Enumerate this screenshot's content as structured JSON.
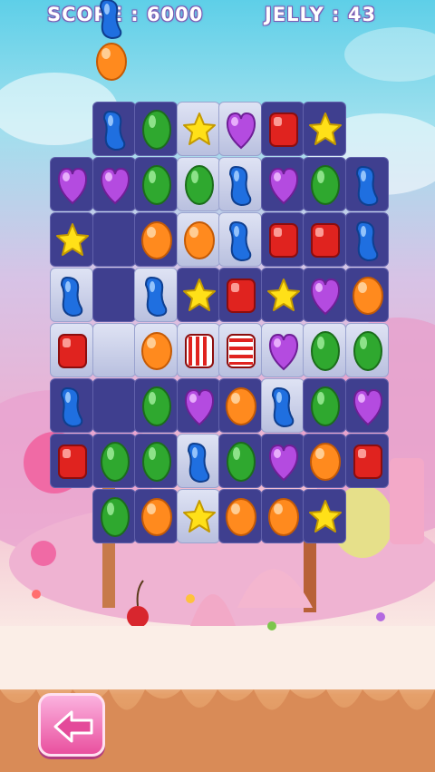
{
  "hud": {
    "score_label": "SCORE : 6000",
    "jelly_label": "JELLY : 43"
  },
  "colors": {
    "board": "#3f3f8f",
    "jelly_tile": "#d3d8ee",
    "hud_text": "#ffffff",
    "back_button": "#f07cc0"
  },
  "board": {
    "columns": 8,
    "rows": 8,
    "cells": [
      [
        "empty",
        "blue-bean",
        "green-oval",
        "yellow-star",
        "purple-heart",
        "red-square",
        "yellow-star",
        "empty"
      ],
      [
        "purple-heart",
        "purple-heart",
        "green-oval",
        "green-oval",
        "blue-bean",
        "purple-heart",
        "green-oval",
        "blue-bean"
      ],
      [
        "yellow-star",
        "empty",
        "orange-oval",
        "orange-oval",
        "blue-bean",
        "red-square",
        "red-square",
        "blue-bean"
      ],
      [
        "blue-bean",
        "empty",
        "blue-bean",
        "yellow-star",
        "red-square",
        "yellow-star",
        "purple-heart",
        "orange-oval"
      ],
      [
        "red-square",
        "empty",
        "orange-oval",
        "red-striped",
        "red-striped-h",
        "purple-heart",
        "green-oval",
        "green-oval"
      ],
      [
        "blue-bean",
        "empty",
        "green-oval",
        "purple-heart",
        "orange-oval",
        "blue-bean",
        "green-oval",
        "purple-heart"
      ],
      [
        "red-square",
        "green-oval",
        "green-oval",
        "blue-bean",
        "green-oval",
        "purple-heart",
        "orange-oval",
        "red-square"
      ],
      [
        "empty",
        "green-oval",
        "orange-oval",
        "yellow-star",
        "orange-oval",
        "orange-oval",
        "yellow-star",
        "empty"
      ]
    ],
    "jelly": [
      [
        0,
        0,
        0,
        1,
        1,
        0,
        0,
        0
      ],
      [
        0,
        0,
        0,
        1,
        1,
        0,
        0,
        0
      ],
      [
        0,
        0,
        0,
        1,
        1,
        0,
        0,
        0
      ],
      [
        1,
        0,
        1,
        0,
        0,
        0,
        0,
        0
      ],
      [
        1,
        1,
        1,
        1,
        1,
        1,
        1,
        1
      ],
      [
        0,
        0,
        0,
        0,
        0,
        1,
        0,
        0
      ],
      [
        0,
        0,
        0,
        1,
        0,
        0,
        0,
        0
      ],
      [
        0,
        0,
        0,
        1,
        0,
        0,
        0,
        0
      ]
    ]
  },
  "falling_candies": [
    "blue-bean",
    "orange-oval"
  ],
  "back_button": {
    "icon": "left-arrow-icon"
  }
}
